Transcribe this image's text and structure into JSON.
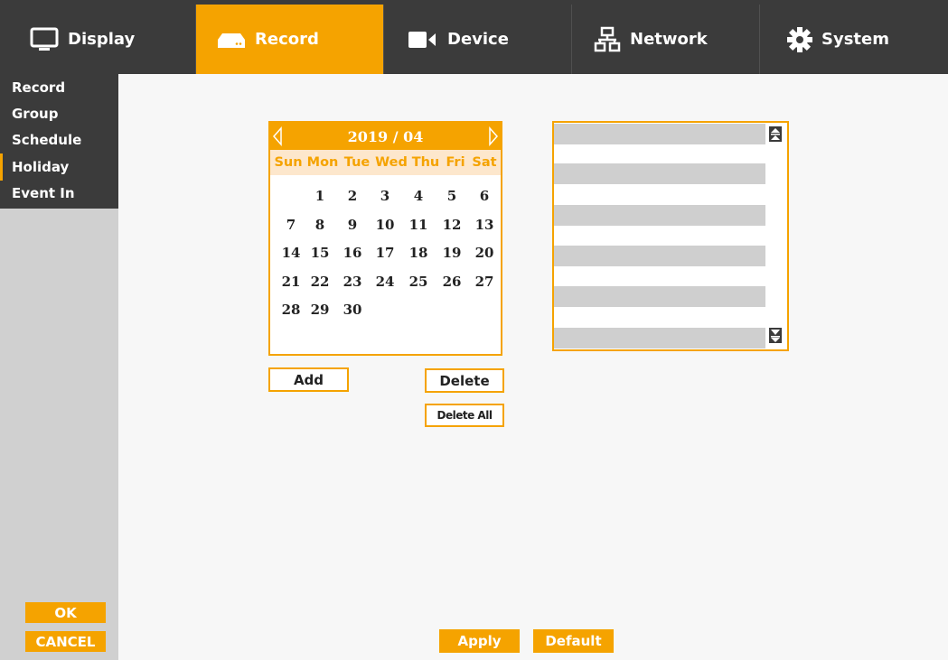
{
  "tabs": [
    {
      "label": "Display",
      "icon": "monitor-icon"
    },
    {
      "label": "Record",
      "icon": "recorder-icon",
      "active": true
    },
    {
      "label": "Device",
      "icon": "camera-icon"
    },
    {
      "label": "Network",
      "icon": "network-icon"
    },
    {
      "label": "System",
      "icon": "gear-icon"
    }
  ],
  "sidebar": {
    "items": [
      {
        "label": "Record"
      },
      {
        "label": "Group"
      },
      {
        "label": "Schedule"
      },
      {
        "label": "Holiday",
        "active": true
      },
      {
        "label": "Event In"
      }
    ],
    "ok_label": "OK",
    "cancel_label": "CANCEL"
  },
  "calendar": {
    "month_label": "2019 / 04",
    "weekdays": [
      "Sun",
      "Mon",
      "Tue",
      "Wed",
      "Thu",
      "Fri",
      "Sat"
    ],
    "weeks": [
      [
        "",
        "1",
        "2",
        "3",
        "4",
        "5",
        "6"
      ],
      [
        "7",
        "8",
        "9",
        "10",
        "11",
        "12",
        "13"
      ],
      [
        "14",
        "15",
        "16",
        "17",
        "18",
        "19",
        "20"
      ],
      [
        "21",
        "22",
        "23",
        "24",
        "25",
        "26",
        "27"
      ],
      [
        "28",
        "29",
        "30",
        "",
        "",
        "",
        ""
      ]
    ]
  },
  "buttons": {
    "add_label": "Add",
    "delete_label": "Delete",
    "delete_all_label": "Delete All"
  },
  "holiday_list": {
    "rows": [
      "",
      "",
      "",
      "",
      "",
      ""
    ]
  },
  "footer": {
    "apply_label": "Apply",
    "default_label": "Default"
  },
  "colors": {
    "accent": "#f5a300",
    "bar": "#3b3b3b",
    "sidebar": "#d0d0d0",
    "background": "#f7f7f7"
  }
}
